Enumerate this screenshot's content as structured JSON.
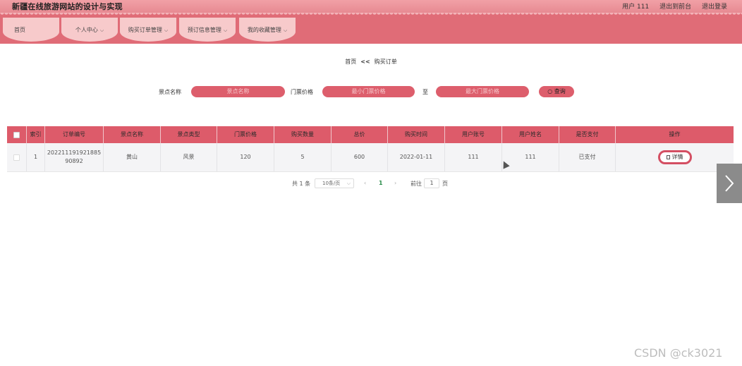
{
  "header": {
    "title": "新疆在线旅游网站的设计与实现",
    "user": "用户 111",
    "back_frontend": "退出到前台",
    "logout": "退出登录"
  },
  "nav": {
    "items": [
      {
        "label": "首页",
        "chevron": false
      },
      {
        "label": "个人中心",
        "chevron": true
      },
      {
        "label": "购买订单管理",
        "chevron": true
      },
      {
        "label": "预订信息管理",
        "chevron": true
      },
      {
        "label": "我的收藏管理",
        "chevron": true
      }
    ]
  },
  "breadcrumb": {
    "home": "首页",
    "sep": "<<",
    "current": "购买订单"
  },
  "search": {
    "name_label": "景点名称",
    "name_placeholder": "景点名称",
    "price_label": "门票价格",
    "min_placeholder": "最小门票价格",
    "to_label": "至",
    "max_placeholder": "最大门票价格",
    "query_label": "查询"
  },
  "table": {
    "headers": [
      "索引",
      "订单编号",
      "景点名称",
      "景点类型",
      "门票价格",
      "购买数量",
      "总价",
      "购买时间",
      "用户账号",
      "用户姓名",
      "是否支付",
      "操作"
    ],
    "rows": [
      {
        "index": "1",
        "order_no_line1": "202211191921885",
        "order_no_line2": "90892",
        "name": "黄山",
        "type": "风景",
        "price": "120",
        "qty": "5",
        "total": "600",
        "time": "2022-01-11",
        "account": "111",
        "username": "111",
        "paid": "已支付",
        "detail": "详情"
      }
    ]
  },
  "pagination": {
    "total": "共 1 条",
    "page_size": "10条/页",
    "current_page": "1",
    "goto_label": "前往",
    "goto_value": "1",
    "page_suffix": "页"
  },
  "watermark": "CSDN @ck3021",
  "colors": {
    "accent": "#dd5b6a",
    "nav_bg": "#e06c77",
    "nav_tab": "#f7cacb",
    "active_page": "#2a8c4a"
  }
}
